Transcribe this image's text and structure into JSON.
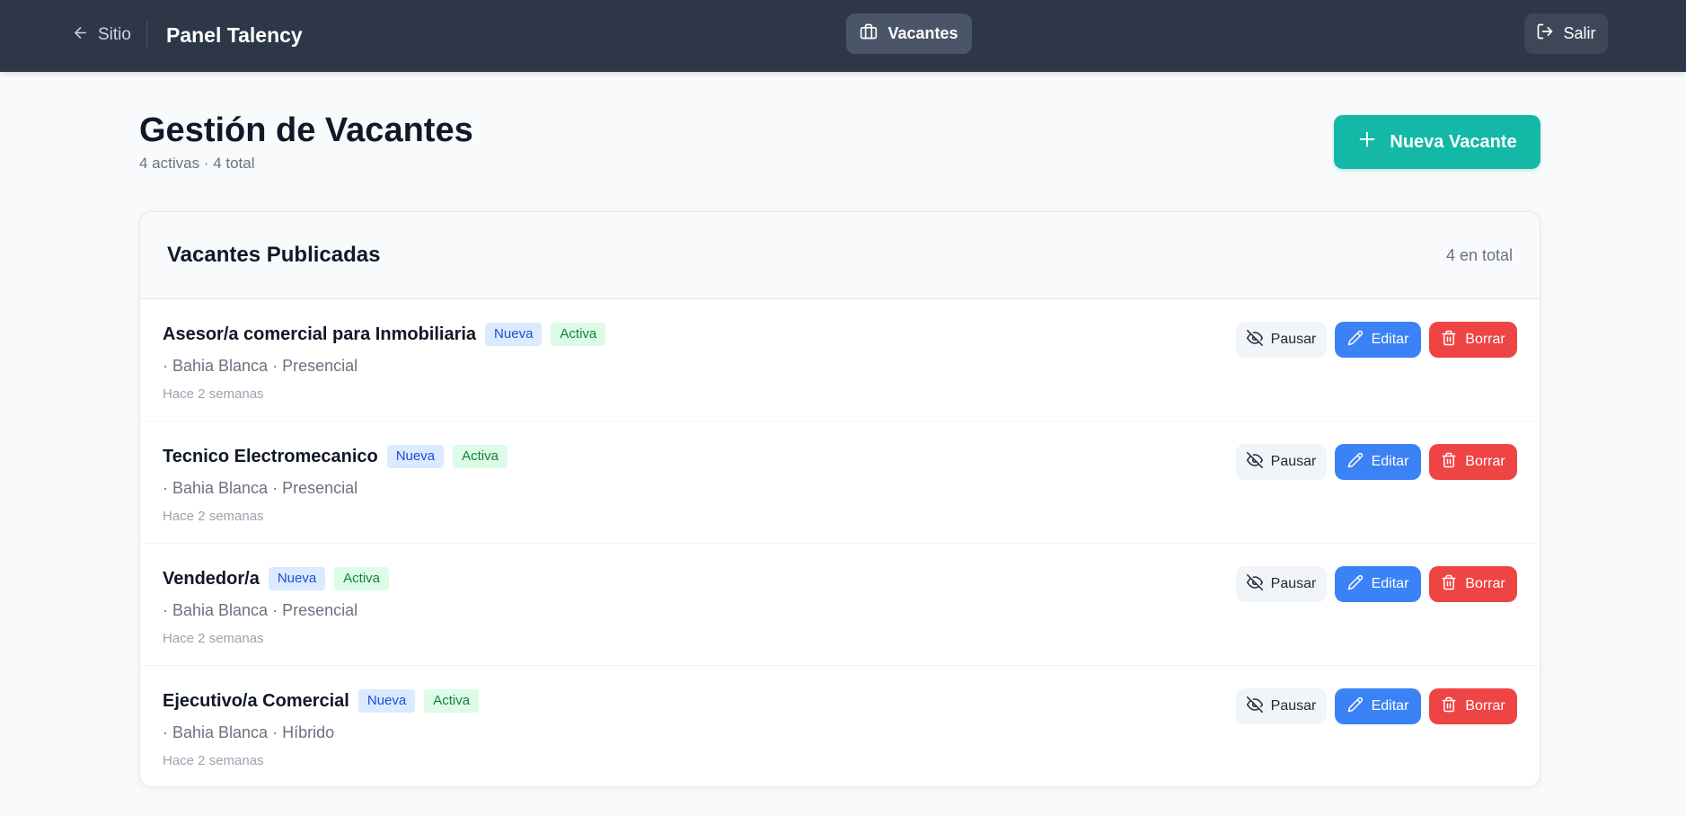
{
  "topbar": {
    "back_label": "Sitio",
    "brand": "Panel Talency",
    "nav_active": "Vacantes",
    "logout_label": "Salir"
  },
  "page": {
    "title": "Gestión de Vacantes",
    "subtitle": "4 activas · 4 total",
    "new_button": "Nueva Vacante"
  },
  "card": {
    "title": "Vacantes Publicadas",
    "count": "4 en total"
  },
  "actions": {
    "pause": "Pausar",
    "edit": "Editar",
    "delete": "Borrar"
  },
  "jobs": [
    {
      "title": "Asesor/a comercial para Inmobiliaria",
      "badge_new": "Nueva",
      "badge_status": "Activa",
      "meta": "· Bahia Blanca · Presencial",
      "time": "Hace 2 semanas"
    },
    {
      "title": "Tecnico Electromecanico",
      "badge_new": "Nueva",
      "badge_status": "Activa",
      "meta": "· Bahia Blanca · Presencial",
      "time": "Hace 2 semanas"
    },
    {
      "title": "Vendedor/a",
      "badge_new": "Nueva",
      "badge_status": "Activa",
      "meta": "· Bahia Blanca · Presencial",
      "time": "Hace 2 semanas"
    },
    {
      "title": "Ejecutivo/a Comercial",
      "badge_new": "Nueva",
      "badge_status": "Activa",
      "meta": "· Bahia Blanca · Híbrido",
      "time": "Hace 2 semanas"
    }
  ],
  "colors": {
    "topbar": "#2d3748",
    "accent": "#14b8a6",
    "edit": "#3b82f6",
    "delete": "#ef4444"
  },
  "icons": {
    "back": "arrow-left-icon",
    "nav": "briefcase-icon",
    "logout": "log-out-icon",
    "new": "plus-icon",
    "pause": "eye-off-icon",
    "edit": "pencil-icon",
    "delete": "trash-icon"
  }
}
